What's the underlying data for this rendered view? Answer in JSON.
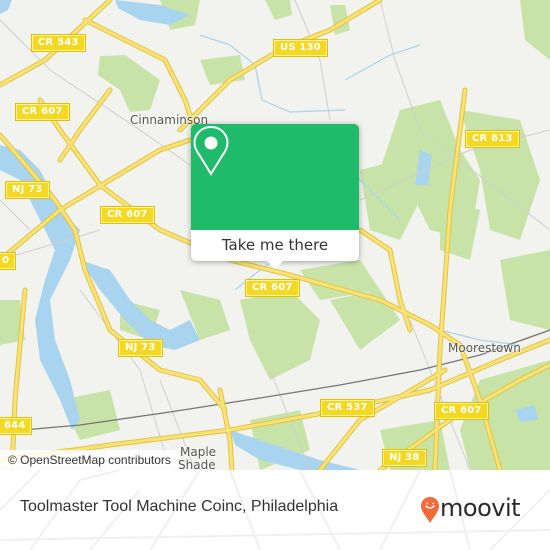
{
  "map": {
    "colors": {
      "land": "#f2f2ee",
      "park": "#c8e3a8",
      "water": "#a8d4ef",
      "road_major": "#f5dc5a",
      "road_minor": "#c8c8c8",
      "railway": "#777777",
      "label_bg": "#f5d821"
    },
    "road_labels": [
      {
        "id": "cr543",
        "text": "CR 543"
      },
      {
        "id": "us130",
        "text": "US 130"
      },
      {
        "id": "cr607_nw",
        "text": "CR 607"
      },
      {
        "id": "cr613",
        "text": "CR 613"
      },
      {
        "id": "nj73_n",
        "text": "NJ 73"
      },
      {
        "id": "cr607_w",
        "text": "CR 607"
      },
      {
        "id": "cr_cut",
        "text": "0"
      },
      {
        "id": "cr607_c",
        "text": "CR 607"
      },
      {
        "id": "nj73_s",
        "text": "NJ 73"
      },
      {
        "id": "cr644",
        "text": "644"
      },
      {
        "id": "cr537",
        "text": "CR 537"
      },
      {
        "id": "cr607_e",
        "text": "CR 607"
      },
      {
        "id": "nj38",
        "text": "NJ 38"
      }
    ],
    "place_labels": [
      {
        "id": "cinnaminson",
        "text": "Cinnaminson"
      },
      {
        "id": "moorestown",
        "text": "Moorestown"
      },
      {
        "id": "maple_shade_1",
        "text": "Maple"
      },
      {
        "id": "maple_shade_2",
        "text": "Shade"
      }
    ],
    "attribution": "© OpenStreetMap contributors"
  },
  "popup": {
    "icon": "map-pin-icon",
    "button_label": "Take me there",
    "color": "#1fba6a"
  },
  "footer": {
    "title": "Toolmaster Tool Machine Coinc, Philadelphia",
    "logo_text": "moovit",
    "logo_color": "#f26b3a"
  }
}
